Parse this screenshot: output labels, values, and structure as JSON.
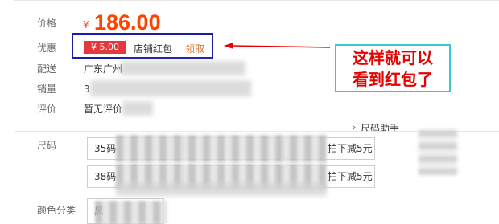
{
  "price": {
    "label": "价格",
    "currency": "¥",
    "amount": "186.00"
  },
  "promotion": {
    "label": "优惠",
    "coupon": "¥ 5.00",
    "store_coupon": "店铺红包",
    "claim": "领取"
  },
  "shipping": {
    "label": "配送",
    "value": "广东广州"
  },
  "sales": {
    "label": "销量",
    "value": "3"
  },
  "reviews": {
    "label": "评价",
    "value": "暂无评价"
  },
  "annotation": {
    "line1": "这样就可以",
    "line2": "看到红包了"
  },
  "size_guide": {
    "chevron": "›",
    "label": "尺码助手"
  },
  "size": {
    "label": "尺码",
    "options": [
      {
        "prefix": "35码",
        "suffix": "拍下减5元"
      },
      {
        "prefix": "38码",
        "suffix": "拍下减5元"
      }
    ]
  },
  "color": {
    "label": "颜色分类",
    "value": "黑"
  },
  "colors": {
    "promo_border": "#1a1aa8",
    "annotation_text": "#e60000",
    "annotation_border": "#37c8d3",
    "price": "#ff4400",
    "coupon_bg": "#e4393c"
  }
}
